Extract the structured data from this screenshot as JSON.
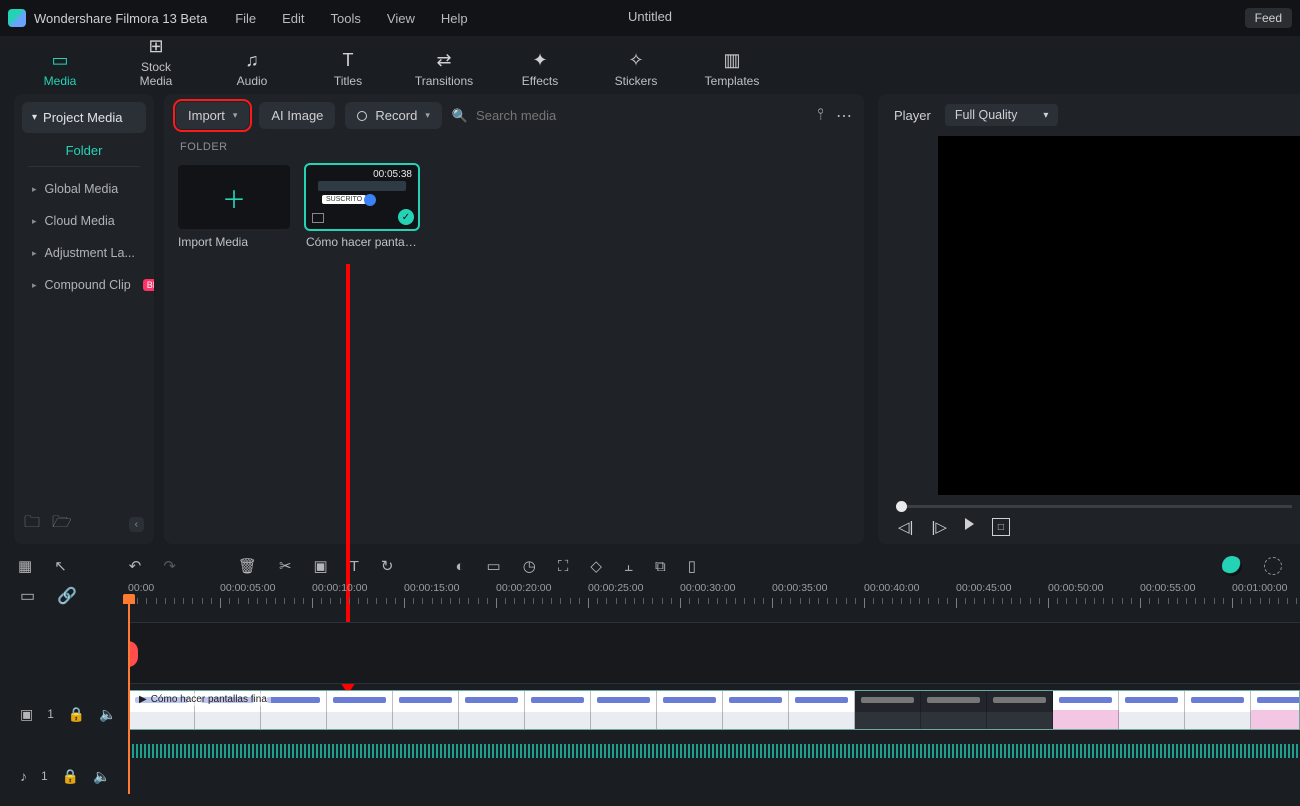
{
  "app": {
    "name": "Wondershare Filmora 13 Beta",
    "doc_title": "Untitled",
    "feedback": "Feed"
  },
  "menu": {
    "file": "File",
    "edit": "Edit",
    "tools": "Tools",
    "view": "View",
    "help": "Help"
  },
  "tabs": {
    "media": "Media",
    "stock": "Stock Media",
    "audio": "Audio",
    "titles": "Titles",
    "transitions": "Transitions",
    "effects": "Effects",
    "stickers": "Stickers",
    "templates": "Templates"
  },
  "sidebar": {
    "project_media": "Project Media",
    "folder_tab": "Folder",
    "items": [
      "Global Media",
      "Cloud Media",
      "Adjustment La...",
      "Compound Clip"
    ],
    "badge": "BETA"
  },
  "toolbar": {
    "import": "Import",
    "ai_image": "AI Image",
    "record": "Record",
    "search_placeholder": "Search media",
    "folder_label": "FOLDER"
  },
  "thumbs": {
    "import_media": "Import Media",
    "clip_duration": "00:05:38",
    "clip_caption": "Cómo hacer pantallas ...",
    "clip_tag": "SUSCRITO"
  },
  "player": {
    "label": "Player",
    "quality": "Full Quality"
  },
  "ruler": {
    "labels": [
      "00:00",
      "00:00:05:00",
      "00:00:10:00",
      "00:00:15:00",
      "00:00:20:00",
      "00:00:25:00",
      "00:00:30:00",
      "00:00:35:00",
      "00:00:40:00",
      "00:00:45:00",
      "00:00:50:00",
      "00:00:55:00",
      "00:01:00:00"
    ]
  },
  "timeline": {
    "clip_title": "Cómo hacer pantallas fina",
    "video_track_index": "1",
    "audio_track_index": "1"
  }
}
